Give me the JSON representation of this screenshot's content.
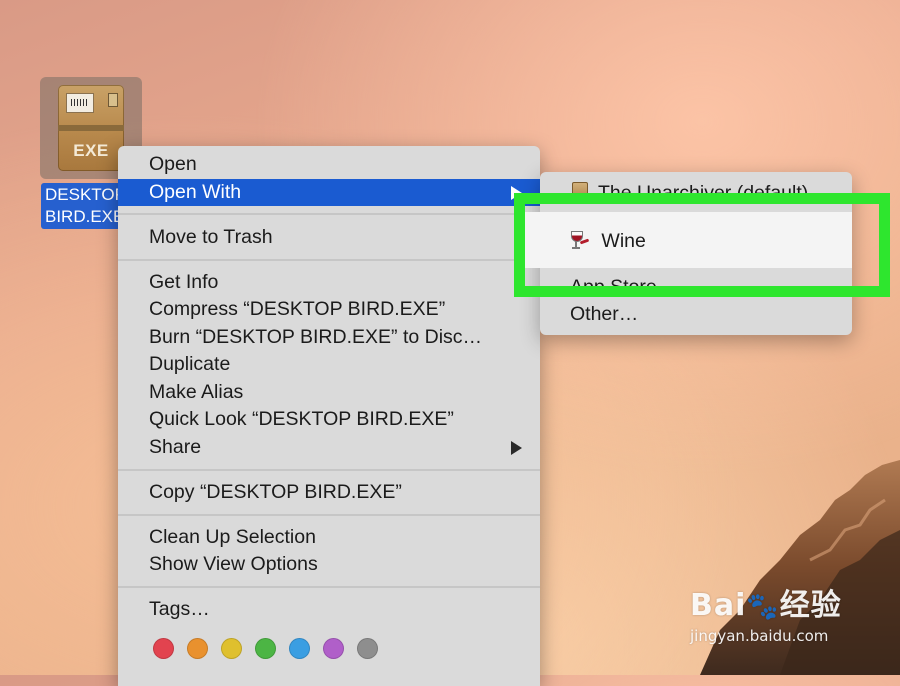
{
  "desktop": {
    "file_icon_ext": "EXE",
    "file_name": "DESKTOP\nBIRD.EXE"
  },
  "context_menu": {
    "items": [
      {
        "label": "Open"
      },
      {
        "label": "Open With"
      },
      {
        "label": "Move to Trash"
      },
      {
        "label": "Get Info"
      },
      {
        "label": "Compress “DESKTOP BIRD.EXE”"
      },
      {
        "label": "Burn “DESKTOP BIRD.EXE” to Disc…"
      },
      {
        "label": "Duplicate"
      },
      {
        "label": "Make Alias"
      },
      {
        "label": "Quick Look “DESKTOP BIRD.EXE”"
      },
      {
        "label": "Share"
      },
      {
        "label": "Copy “DESKTOP BIRD.EXE”"
      },
      {
        "label": "Clean Up Selection"
      },
      {
        "label": "Show View Options"
      },
      {
        "label": "Tags…"
      }
    ],
    "tag_colors": [
      {
        "name": "red",
        "color": "#e2434f"
      },
      {
        "name": "orange",
        "color": "#e9912e"
      },
      {
        "name": "yellow",
        "color": "#dfc02e"
      },
      {
        "name": "green",
        "color": "#4cb544"
      },
      {
        "name": "blue",
        "color": "#3a9ee2"
      },
      {
        "name": "purple",
        "color": "#b05fc9"
      },
      {
        "name": "gray",
        "color": "#8e8e8e"
      }
    ]
  },
  "open_with_submenu": {
    "items": [
      {
        "label": "The Unarchiver (default)"
      },
      {
        "label": "Wine"
      },
      {
        "label": "App Store…"
      },
      {
        "label": "Other…"
      }
    ]
  },
  "annotation": {
    "highlight_color": "#2ee62e"
  },
  "watermark": {
    "logo": "Bai",
    "logo_suffix": "经验",
    "url": "jingyan.baidu.com"
  }
}
